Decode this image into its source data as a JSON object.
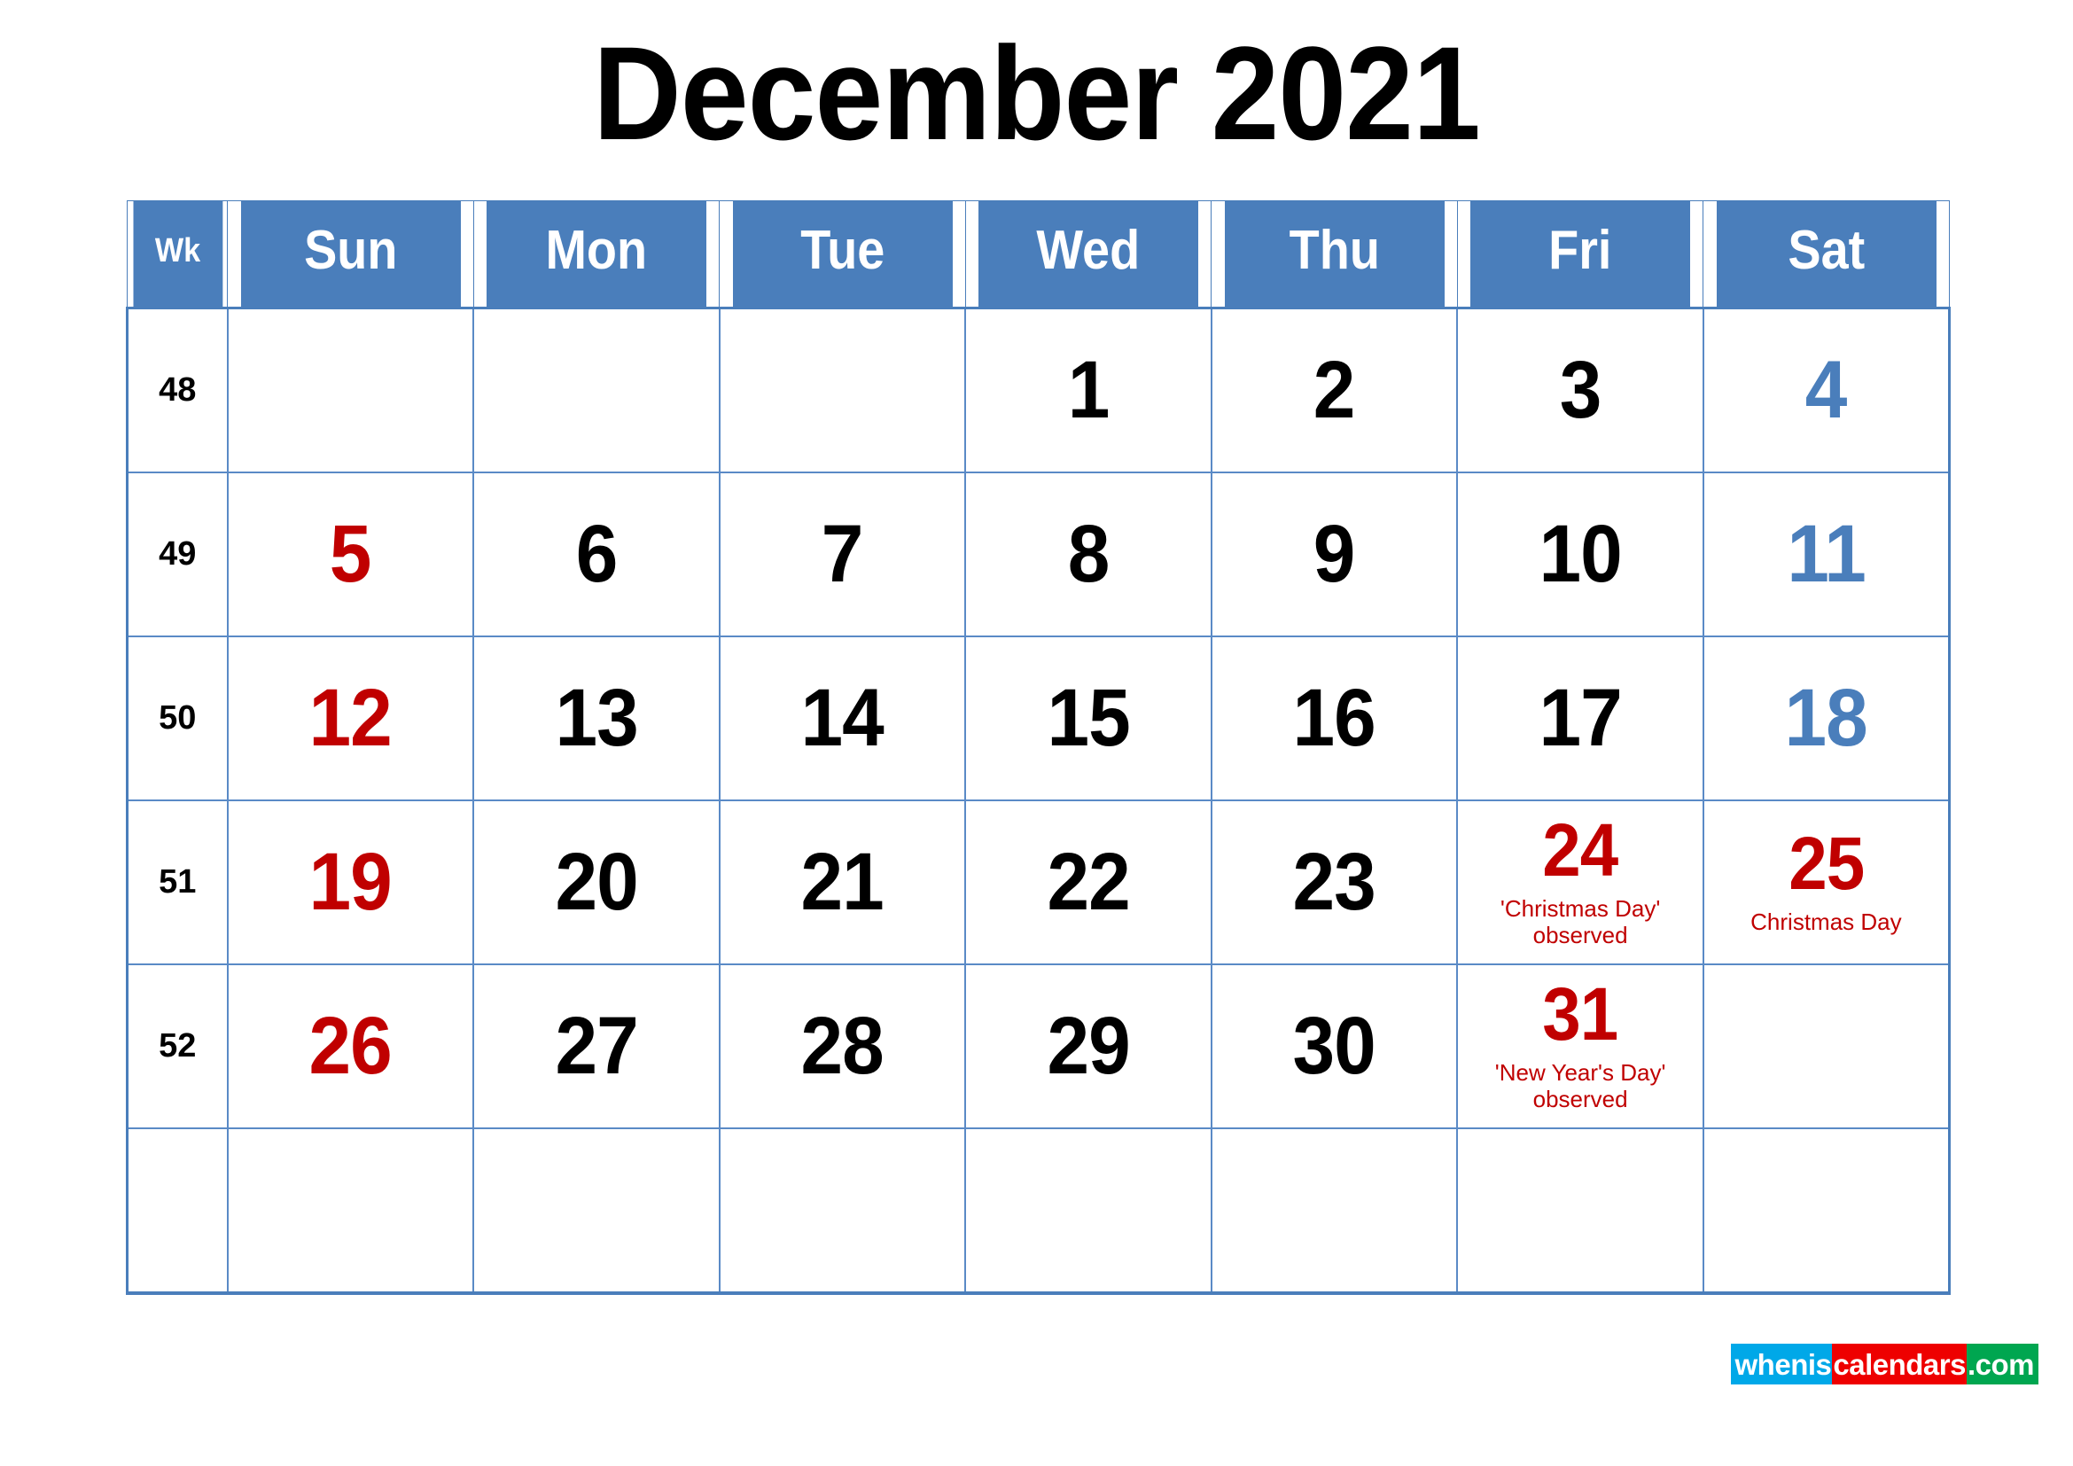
{
  "title": "December 2021",
  "table": {
    "headers": {
      "week": "Wk",
      "days": [
        "Sun",
        "Mon",
        "Tue",
        "Wed",
        "Thu",
        "Fri",
        "Sat"
      ]
    },
    "weeks": [
      {
        "week_number": "48",
        "days": [
          {
            "num": "",
            "kind": "empty",
            "note": ""
          },
          {
            "num": "",
            "kind": "empty",
            "note": ""
          },
          {
            "num": "",
            "kind": "empty",
            "note": ""
          },
          {
            "num": "1",
            "kind": "weekday",
            "note": ""
          },
          {
            "num": "2",
            "kind": "weekday",
            "note": ""
          },
          {
            "num": "3",
            "kind": "weekday",
            "note": ""
          },
          {
            "num": "4",
            "kind": "saturday",
            "note": ""
          }
        ]
      },
      {
        "week_number": "49",
        "days": [
          {
            "num": "5",
            "kind": "sunday",
            "note": ""
          },
          {
            "num": "6",
            "kind": "weekday",
            "note": ""
          },
          {
            "num": "7",
            "kind": "weekday",
            "note": ""
          },
          {
            "num": "8",
            "kind": "weekday",
            "note": ""
          },
          {
            "num": "9",
            "kind": "weekday",
            "note": ""
          },
          {
            "num": "10",
            "kind": "weekday",
            "note": ""
          },
          {
            "num": "11",
            "kind": "saturday",
            "note": ""
          }
        ]
      },
      {
        "week_number": "50",
        "days": [
          {
            "num": "12",
            "kind": "sunday",
            "note": ""
          },
          {
            "num": "13",
            "kind": "weekday",
            "note": ""
          },
          {
            "num": "14",
            "kind": "weekday",
            "note": ""
          },
          {
            "num": "15",
            "kind": "weekday",
            "note": ""
          },
          {
            "num": "16",
            "kind": "weekday",
            "note": ""
          },
          {
            "num": "17",
            "kind": "weekday",
            "note": ""
          },
          {
            "num": "18",
            "kind": "saturday",
            "note": ""
          }
        ]
      },
      {
        "week_number": "51",
        "days": [
          {
            "num": "19",
            "kind": "sunday",
            "note": ""
          },
          {
            "num": "20",
            "kind": "weekday",
            "note": ""
          },
          {
            "num": "21",
            "kind": "weekday",
            "note": ""
          },
          {
            "num": "22",
            "kind": "weekday",
            "note": ""
          },
          {
            "num": "23",
            "kind": "weekday",
            "note": ""
          },
          {
            "num": "24",
            "kind": "holiday",
            "note": "'Christmas Day'\nobserved"
          },
          {
            "num": "25",
            "kind": "holiday",
            "note": "Christmas Day"
          }
        ]
      },
      {
        "week_number": "52",
        "days": [
          {
            "num": "26",
            "kind": "sunday",
            "note": ""
          },
          {
            "num": "27",
            "kind": "weekday",
            "note": ""
          },
          {
            "num": "28",
            "kind": "weekday",
            "note": ""
          },
          {
            "num": "29",
            "kind": "weekday",
            "note": ""
          },
          {
            "num": "30",
            "kind": "weekday",
            "note": ""
          },
          {
            "num": "31",
            "kind": "holiday",
            "note": "'New Year's Day'\nobserved"
          },
          {
            "num": "",
            "kind": "empty",
            "note": ""
          }
        ]
      },
      {
        "week_number": "",
        "days": [
          {
            "num": "",
            "kind": "empty",
            "note": ""
          },
          {
            "num": "",
            "kind": "empty",
            "note": ""
          },
          {
            "num": "",
            "kind": "empty",
            "note": ""
          },
          {
            "num": "",
            "kind": "empty",
            "note": ""
          },
          {
            "num": "",
            "kind": "empty",
            "note": ""
          },
          {
            "num": "",
            "kind": "empty",
            "note": ""
          },
          {
            "num": "",
            "kind": "empty",
            "note": ""
          }
        ]
      }
    ]
  },
  "logo": {
    "part1": "whenis",
    "part2": "calendars",
    "part3": ".com"
  },
  "colors": {
    "header_blue": "#4a7ebb",
    "saturday_blue": "#4a7ebb",
    "sunday_red": "#c00000",
    "holiday_red": "#c00000",
    "weekday_black": "#000000",
    "grid_blue": "#5a8ac6",
    "logo_cyan": "#00a8e8",
    "logo_red": "#ee0000",
    "logo_green": "#00a650"
  }
}
